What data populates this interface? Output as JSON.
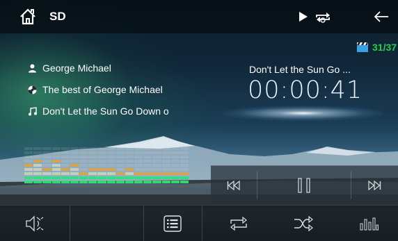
{
  "header": {
    "source": "SD"
  },
  "track_counter": "31/37",
  "info": {
    "artist": "George Michael",
    "album": "The best of George Michael",
    "song": "Don't Let the Sun Go Down o"
  },
  "now_playing": {
    "title": "Don't Let the Sun Go ...",
    "elapsed": "00:00:41"
  },
  "equalizer": {
    "levels": [
      0.55,
      0.72,
      0.48,
      0.62,
      0.45,
      0.5,
      0.38,
      0.42,
      0.4,
      0.45,
      0.38,
      0.4,
      0.36,
      0.38,
      0.35,
      0.33,
      0.3,
      0.28
    ]
  },
  "colors": {
    "counter": "#22d04a",
    "eq_low": "#2ee07a",
    "eq_mid": "#d0d8c0",
    "eq_peak": "#e9a030"
  },
  "icons": [
    "home-icon",
    "play-status-icon",
    "repeat-status-icon",
    "back-icon",
    "clapper-icon",
    "artist-icon",
    "album-icon",
    "song-icon",
    "previous-icon",
    "pause-icon",
    "next-icon",
    "volume-icon",
    "playlist-icon",
    "repeat-icon",
    "shuffle-icon",
    "equalizer-icon"
  ]
}
